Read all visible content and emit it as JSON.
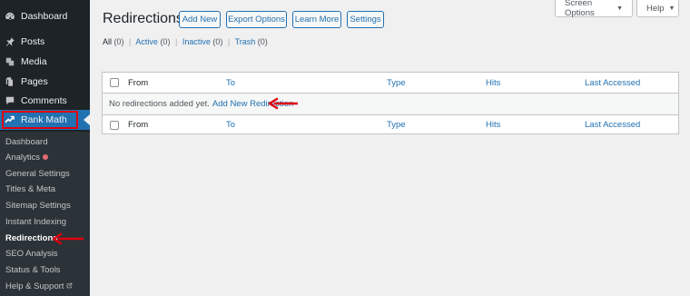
{
  "sidebar": {
    "menu": [
      {
        "label": "Dashboard",
        "icon": "dashboard-icon"
      },
      {
        "label": "Posts",
        "icon": "pin-icon"
      },
      {
        "label": "Media",
        "icon": "media-icon"
      },
      {
        "label": "Pages",
        "icon": "pages-icon"
      },
      {
        "label": "Comments",
        "icon": "comment-icon"
      },
      {
        "label": "Rank Math",
        "icon": "rank-math-icon"
      }
    ],
    "submenu": [
      {
        "label": "Dashboard"
      },
      {
        "label": "Analytics"
      },
      {
        "label": "General Settings"
      },
      {
        "label": "Titles & Meta"
      },
      {
        "label": "Sitemap Settings"
      },
      {
        "label": "Instant Indexing"
      },
      {
        "label": "Redirections"
      },
      {
        "label": "SEO Analysis"
      },
      {
        "label": "Status & Tools"
      },
      {
        "label": "Help & Support"
      }
    ]
  },
  "top": {
    "screen_options": "Screen Options",
    "help": "Help"
  },
  "header": {
    "title": "Redirections",
    "buttons": [
      "Add New",
      "Export Options",
      "Learn More",
      "Settings"
    ]
  },
  "filters": {
    "all": "All",
    "all_count": "(0)",
    "active": "Active",
    "active_count": "(0)",
    "inactive": "Inactive",
    "inactive_count": "(0)",
    "trash": "Trash",
    "trash_count": "(0)",
    "separator": "|"
  },
  "table": {
    "columns": [
      "From",
      "To",
      "Type",
      "Hits",
      "Last Accessed"
    ],
    "empty_text": "No redirections added yet.",
    "empty_link": "Add New Redirection"
  },
  "colors": {
    "sidebar_bg": "#1d2327",
    "submenu_bg": "#2c3338",
    "accent": "#2271b1",
    "annotation_red": "#e0000f"
  }
}
